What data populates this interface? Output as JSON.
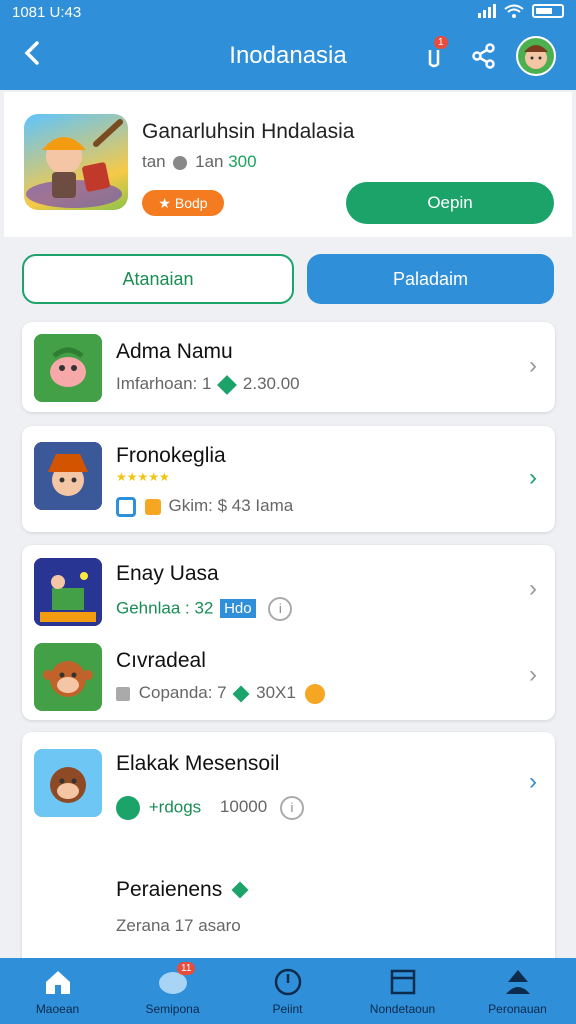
{
  "status": {
    "time": "1081 U:43"
  },
  "header": {
    "title": "Inodanasia",
    "notif_badge": "1"
  },
  "featured": {
    "title": "Ganarluhsin Hndalasia",
    "sub_prefix": "tan",
    "sub_mid": "1an",
    "sub_num": "300",
    "tag": "Bodp",
    "open_label": "Oepin"
  },
  "tabs": {
    "left": "Atanaian",
    "right": "Paladaim"
  },
  "list": [
    {
      "title": "Adma Namu",
      "sub": "Imfarhoan: 1",
      "value": "2.30.00"
    },
    {
      "title": "Fronokeglia",
      "stars": "★★★★★",
      "sub": "Gkim: $ 43 Iama"
    },
    {
      "title": "Enay Uasa",
      "sub": "Gehnlaa : 32",
      "badge": "Hdo"
    },
    {
      "title": "Cıvradeal",
      "sub": "Copanda: 7",
      "value": "30X1"
    },
    {
      "title": "Elakak Mesensoil",
      "sub": "+rdogs",
      "value": "10000"
    }
  ],
  "footer_item": {
    "title": "Peraienens",
    "sub": "Zerana 17 asaro"
  },
  "bottom_nav": [
    {
      "label": "Maoean",
      "icon": "home-icon"
    },
    {
      "label": "Semipona",
      "icon": "chat-icon",
      "badge": "11"
    },
    {
      "label": "Peiint",
      "icon": "clock-icon"
    },
    {
      "label": "Nondetaoun",
      "icon": "document-icon"
    },
    {
      "label": "Peronauan",
      "icon": "person-icon"
    }
  ]
}
